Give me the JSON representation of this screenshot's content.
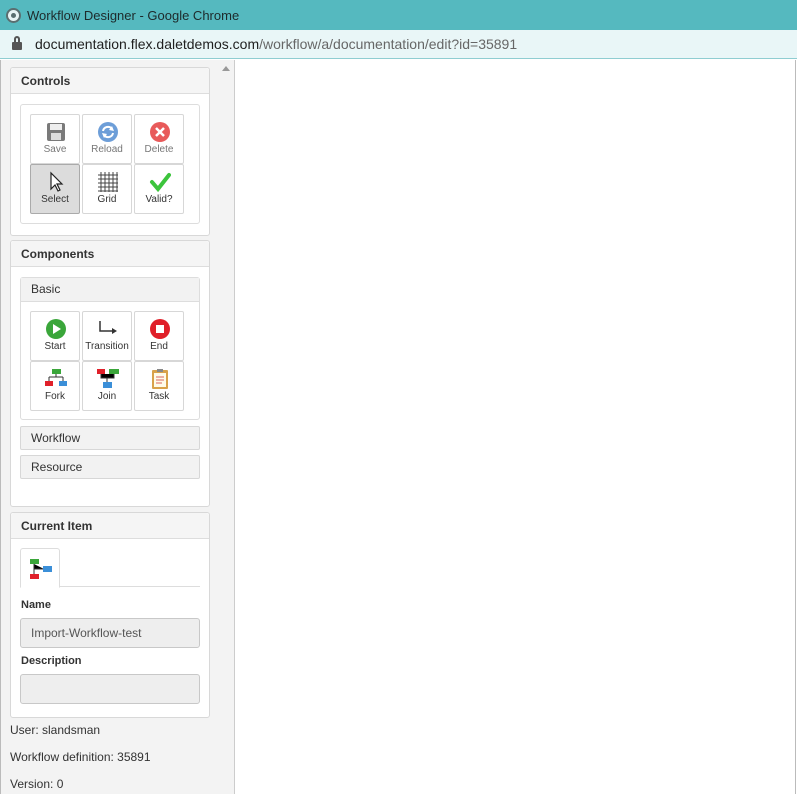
{
  "window": {
    "title": "Workflow Designer - Google Chrome",
    "url_domain": "documentation.flex.daletdemos.com",
    "url_path": "/workflow/a/documentation/edit?id=35891"
  },
  "controls": {
    "header": "Controls",
    "buttons": [
      {
        "label": "Save",
        "icon": "save-icon"
      },
      {
        "label": "Reload",
        "icon": "reload-icon"
      },
      {
        "label": "Delete",
        "icon": "delete-icon"
      },
      {
        "label": "Select",
        "icon": "cursor-icon",
        "selected": true
      },
      {
        "label": "Grid",
        "icon": "grid-icon"
      },
      {
        "label": "Valid?",
        "icon": "checkmark-icon"
      }
    ]
  },
  "components": {
    "header": "Components",
    "basic_label": "Basic",
    "buttons": [
      {
        "label": "Start",
        "icon": "play-icon"
      },
      {
        "label": "Transition",
        "icon": "transition-arrow-icon"
      },
      {
        "label": "End",
        "icon": "stop-icon"
      },
      {
        "label": "Fork",
        "icon": "fork-icon"
      },
      {
        "label": "Join",
        "icon": "join-icon"
      },
      {
        "label": "Task",
        "icon": "clipboard-icon"
      }
    ],
    "sections": [
      "Workflow",
      "Resource"
    ]
  },
  "current_item": {
    "header": "Current Item",
    "tab_icon": "workflow-icon",
    "name_label": "Name",
    "name_value": "Import-Workflow-test",
    "description_label": "Description",
    "description_value": ""
  },
  "footer": {
    "user": "User: slandsman",
    "definition": "Workflow definition: 35891",
    "version": "Version: 0"
  },
  "colors": {
    "titlebar": "#55b9bf",
    "green": "#3aa63a",
    "red": "#e0202a",
    "blue": "#3b8fd8"
  }
}
